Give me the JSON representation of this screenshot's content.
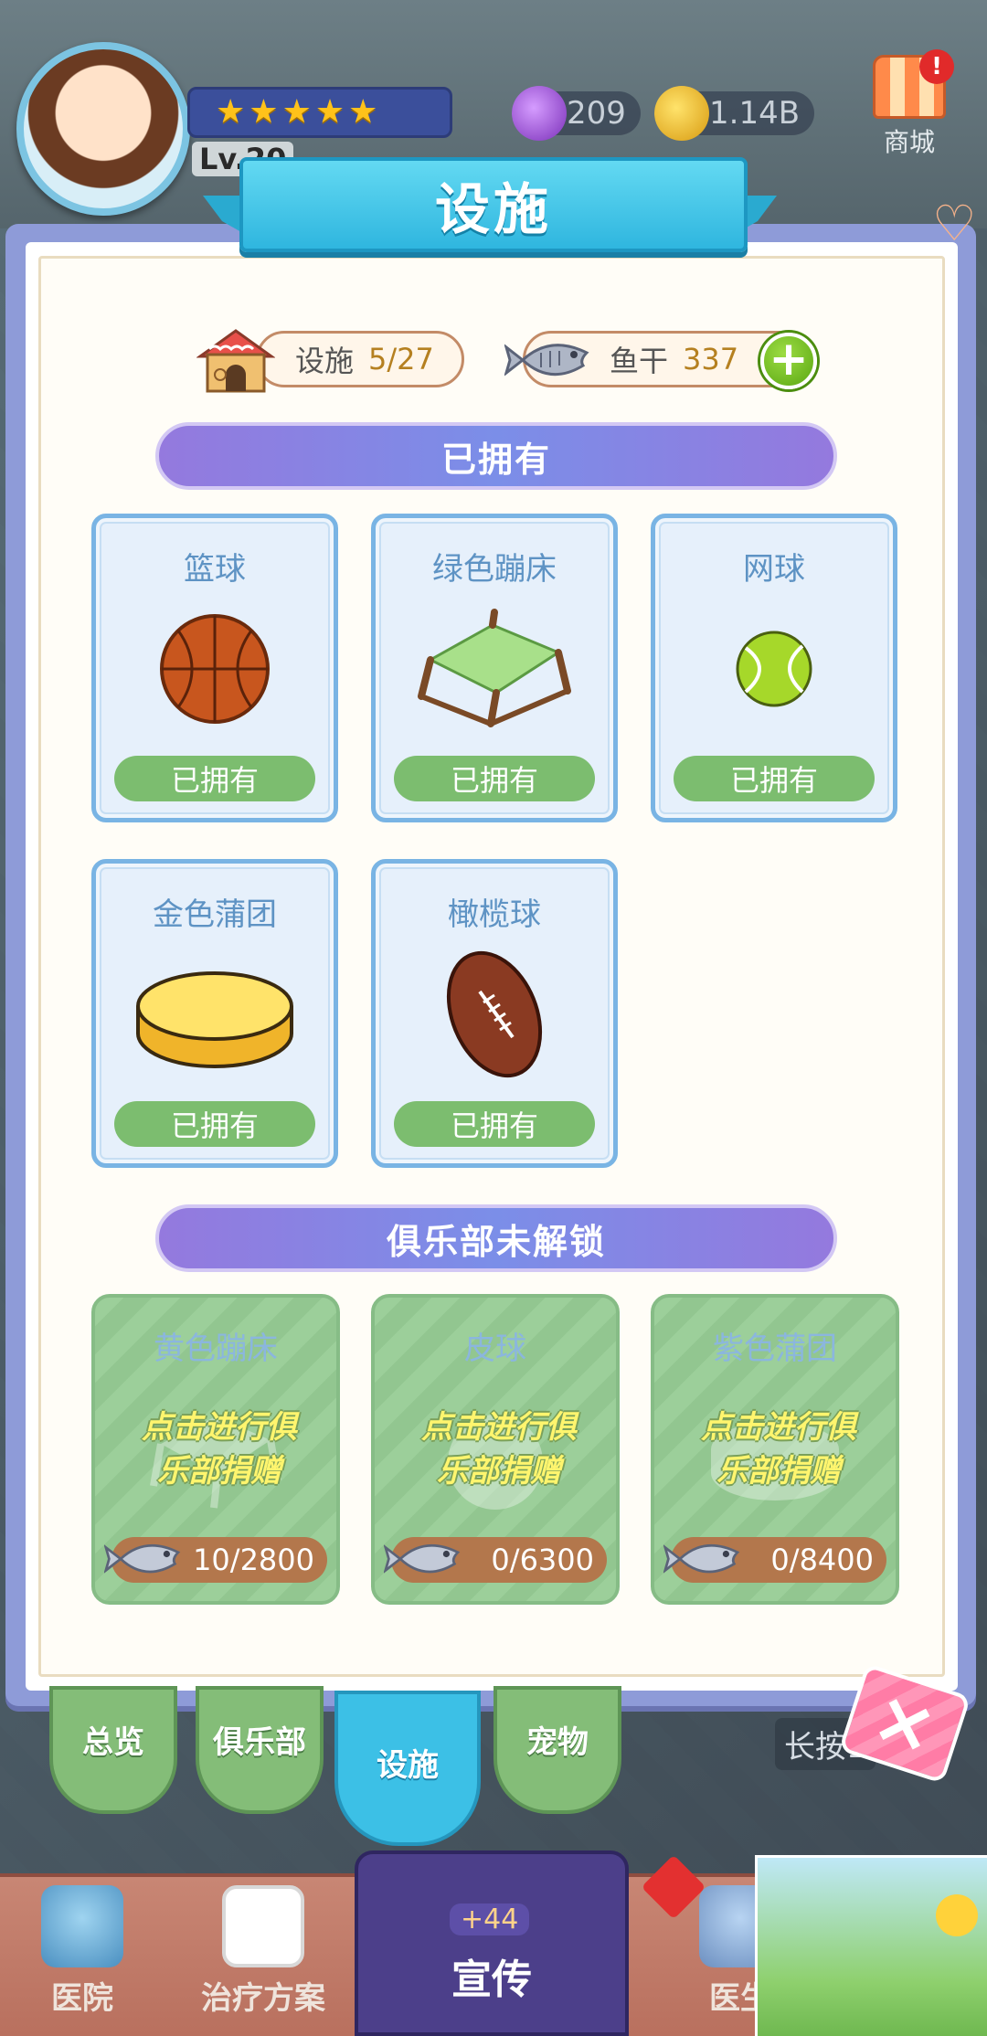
{
  "header": {
    "level_text": "Lv.20",
    "stars": [
      "★",
      "★",
      "★",
      "★",
      "★"
    ],
    "gems": "209",
    "coins": "1.14B",
    "shop_label": "商城",
    "shop_badge": "!"
  },
  "dialog": {
    "title": "设施",
    "facility_counter": {
      "label": "设施",
      "value": "5/27"
    },
    "fish_counter": {
      "label": "鱼干",
      "value": "337"
    },
    "plus_label": "+",
    "owned_section_title": "已拥有",
    "owned_items": [
      {
        "name": "篮球",
        "status": "已拥有",
        "icon": "basketball-icon"
      },
      {
        "name": "绿色蹦床",
        "status": "已拥有",
        "icon": "green-trampoline-icon"
      },
      {
        "name": "网球",
        "status": "已拥有",
        "icon": "tennis-ball-icon"
      },
      {
        "name": "金色蒲团",
        "status": "已拥有",
        "icon": "golden-cushion-icon"
      },
      {
        "name": "橄榄球",
        "status": "已拥有",
        "icon": "rugby-ball-icon"
      }
    ],
    "locked_section_title": "俱乐部未解锁",
    "locked_items": [
      {
        "name": "黄色蹦床",
        "hint_line1": "点击进行俱",
        "hint_line2": "乐部捐赠",
        "cost": "10/2800"
      },
      {
        "name": "皮球",
        "hint_line1": "点击进行俱",
        "hint_line2": "乐部捐赠",
        "cost": "0/6300"
      },
      {
        "name": "紫色蒲团",
        "hint_line1": "点击进行俱",
        "hint_line2": "乐部捐赠",
        "cost": "0/8400"
      }
    ]
  },
  "tabs": [
    {
      "label": "总览"
    },
    {
      "label": "俱乐部"
    },
    {
      "label": "设施"
    },
    {
      "label": "宠物"
    }
  ],
  "longpress_text": "长按1",
  "bottom_nav": {
    "hospital": "医院",
    "treatment": "治疗方案",
    "promo_label": "宣传",
    "promo_badge": "+44",
    "doctor": "医生"
  },
  "colors": {
    "accent_blue": "#3cc0e6",
    "owned_green": "#7cbd6f",
    "section_purple": "#9479de",
    "counter_gold": "#b58020"
  }
}
